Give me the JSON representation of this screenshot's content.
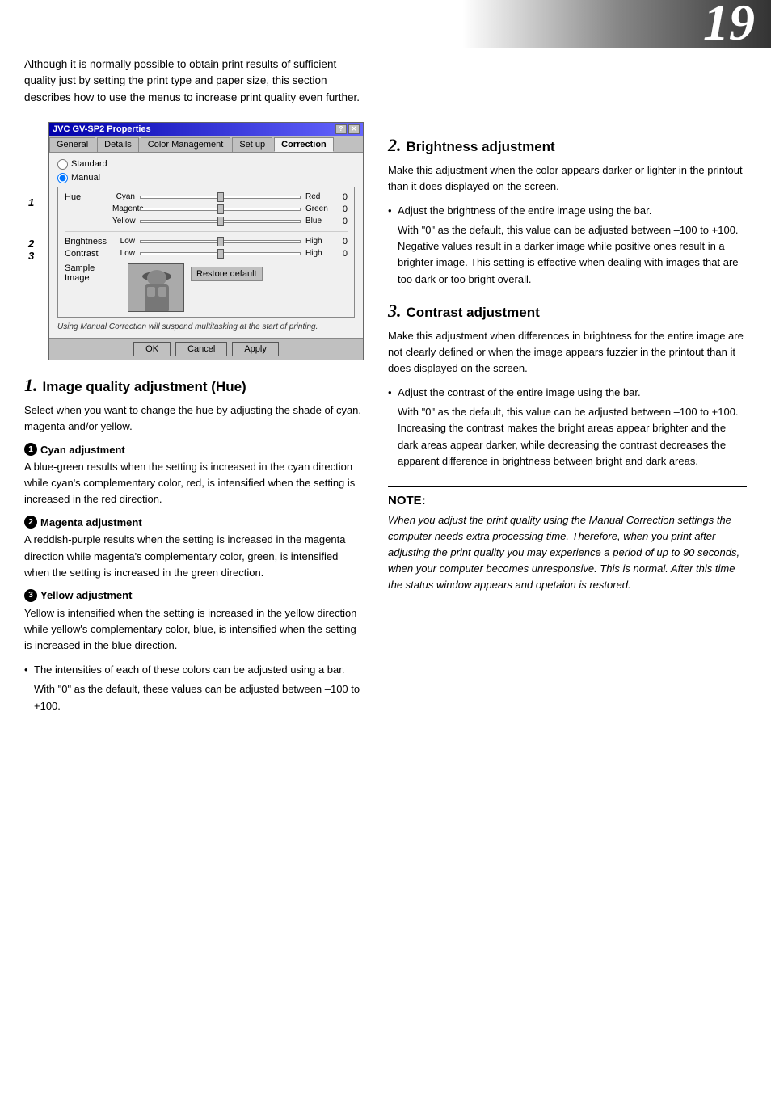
{
  "page": {
    "number": "19",
    "intro": "Although  it is normally possible to obtain print results of sufficient quality just by setting the print type and paper size, this section describes how to use the menus to increase print quality even further."
  },
  "dialog": {
    "title": "JVC GV-SP2 Properties",
    "title_buttons": [
      "?",
      "X"
    ],
    "tabs": [
      "General",
      "Details",
      "Color Management",
      "Set up",
      "Correction"
    ],
    "active_tab": "Correction",
    "radio_standard": "Standard",
    "radio_manual": "Manual",
    "sliders": [
      {
        "label": "Hue",
        "left": "Cyan",
        "right": "Red",
        "value": "0"
      },
      {
        "label": "",
        "left": "Magenta",
        "right": "Green",
        "value": "0"
      },
      {
        "label": "",
        "left": "Yellow",
        "right": "Blue",
        "value": "0"
      },
      {
        "label": "Brightness",
        "left": "Low",
        "right": "High",
        "value": "0"
      },
      {
        "label": "Contrast",
        "left": "Low",
        "right": "High",
        "value": "0"
      }
    ],
    "sample_label": "Sample Image",
    "restore_btn": "Restore default",
    "note": "Using Manual Correction will suspend multitasking at the start of printing.",
    "buttons": [
      "OK",
      "Cancel",
      "Apply"
    ]
  },
  "markers": {
    "m1": "1",
    "m2": "2",
    "m3": "3"
  },
  "sections": [
    {
      "num": "1.",
      "title": "Image quality adjustment (Hue)",
      "body": "Select when you want to change the hue by adjusting the shade of cyan, magenta and/or yellow.",
      "sub": [
        {
          "circle": "1",
          "heading": "Cyan adjustment",
          "text": "A blue-green results when the setting is increased in the cyan direction while cyan's complementary color, red, is intensified when the setting is increased in the red direction."
        },
        {
          "circle": "2",
          "heading": "Magenta adjustment",
          "text": "A reddish-purple results when the setting is increased in the magenta direction while magenta's complementary color, green, is intensified when the setting is increased in the green direction."
        },
        {
          "circle": "3",
          "heading": "Yellow adjustment",
          "text": "Yellow is intensified when the setting is increased in the yellow direction while yellow's complementary color, blue, is intensified when the setting is increased in the blue direction."
        }
      ],
      "bullet": "The intensities of each of these colors can be adjusted using a bar.",
      "bullet2": "With \"0\" as the default, these values can be adjusted between –100 to +100."
    }
  ],
  "section2": {
    "num": "2.",
    "title": "Brightness adjustment",
    "body": "Make this adjustment when the color appears darker or lighter in the printout than it does displayed on the screen.",
    "bullet1": "Adjust the brightness of the entire image using the bar.",
    "bullet1_sub": "With \"0\" as the default, this value can be adjusted between –100 to +100. Negative values result in a darker image while positive ones result in a brighter image. This setting is effective when dealing with images that are too dark or too bright overall."
  },
  "section3": {
    "num": "3.",
    "title": "Contrast adjustment",
    "body": "Make this adjustment when differences in brightness for the entire image are not clearly defined or when the image appears fuzzier in the printout than it does displayed on the screen.",
    "bullet1": "Adjust the contrast of the entire image using the bar.",
    "bullet1_sub": "With \"0\" as the default, this value can be adjusted between –100 to +100. Increasing the contrast makes the bright areas appear brighter and the dark areas appear darker, while decreasing the contrast decreases the apparent difference in brightness between bright and dark areas."
  },
  "note": {
    "title": "NOTE:",
    "text": "When you adjust the print quality using the Manual Correction settings the computer needs extra processing time. Therefore, when you print after adjusting the print quality you may experience a period of up to 90 seconds, when your computer becomes unresponsive. This is normal. After this time the status window appears and opetaion is restored."
  }
}
